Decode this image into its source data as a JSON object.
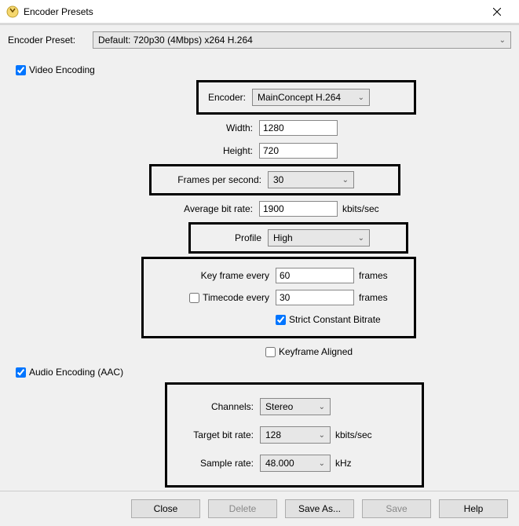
{
  "window": {
    "title": "Encoder Presets"
  },
  "preset_row": {
    "label": "Encoder Preset:",
    "value": "Default: 720p30 (4Mbps) x264 H.264"
  },
  "video": {
    "section_label": "Video Encoding",
    "checked": true,
    "encoder_label": "Encoder:",
    "encoder_value": "MainConcept H.264",
    "width_label": "Width:",
    "width_value": "1280",
    "height_label": "Height:",
    "height_value": "720",
    "fps_label": "Frames per second:",
    "fps_value": "30",
    "avg_bitrate_label": "Average bit rate:",
    "avg_bitrate_value": "1900",
    "avg_bitrate_unit": "kbits/sec",
    "profile_label": "Profile",
    "profile_value": "High",
    "keyframe_label": "Key frame every",
    "keyframe_value": "60",
    "keyframe_unit": "frames",
    "timecode_label": "Timecode every",
    "timecode_checked": false,
    "timecode_value": "30",
    "timecode_unit": "frames",
    "strict_cbr_label": "Strict Constant Bitrate",
    "strict_cbr_checked": true,
    "keyframe_aligned_label": "Keyframe Aligned",
    "keyframe_aligned_checked": false
  },
  "audio": {
    "section_label": "Audio Encoding (AAC)",
    "checked": true,
    "channels_label": "Channels:",
    "channels_value": "Stereo",
    "target_bitrate_label": "Target bit rate:",
    "target_bitrate_value": "128",
    "target_bitrate_unit": "kbits/sec",
    "sample_rate_label": "Sample rate:",
    "sample_rate_value": "48.000",
    "sample_rate_unit": "kHz"
  },
  "buttons": {
    "close": "Close",
    "delete": "Delete",
    "save_as": "Save As...",
    "save": "Save",
    "help": "Help"
  }
}
